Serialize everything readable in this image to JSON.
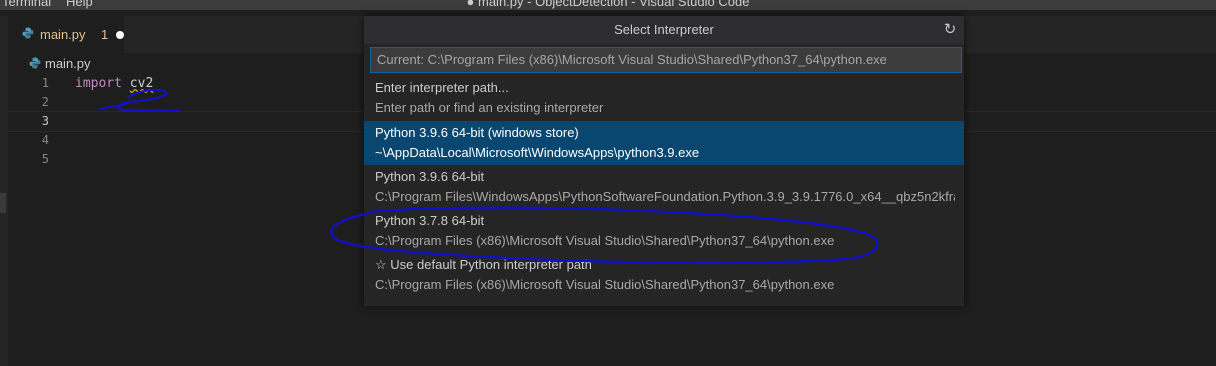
{
  "menu": {
    "terminal": "Terminal",
    "help": "Help"
  },
  "window_title": "● main.py - ObjectDetection - Visual Studio Code",
  "tab": {
    "name": "main.py",
    "problem_count": "1"
  },
  "breadcrumb": {
    "file": "main.py"
  },
  "editor": {
    "line_numbers": [
      "1",
      "2",
      "3",
      "4",
      "5"
    ],
    "line1": {
      "keyword": "import",
      "module": "cv2"
    }
  },
  "quick_pick": {
    "title": "Select Interpreter",
    "input_placeholder": "Current: C:\\Program Files (x86)\\Microsoft Visual Studio\\Shared\\Python37_64\\python.exe",
    "items": [
      {
        "label": "Enter interpreter path...",
        "detail": "Enter path or find an existing interpreter"
      },
      {
        "label": "Python 3.9.6 64-bit (windows store)",
        "detail": "~\\AppData\\Local\\Microsoft\\WindowsApps\\python3.9.exe"
      },
      {
        "label": "Python 3.9.6 64-bit",
        "detail": "C:\\Program Files\\WindowsApps\\PythonSoftwareFoundation.Python.3.9_3.9.1776.0_x64__qbz5n2kfra..."
      },
      {
        "label": "Python 3.7.8 64-bit",
        "detail": "C:\\Program Files (x86)\\Microsoft Visual Studio\\Shared\\Python37_64\\python.exe"
      },
      {
        "label": "Use default Python interpreter path",
        "detail": "C:\\Program Files (x86)\\Microsoft Visual Studio\\Shared\\Python37_64\\python.exe"
      }
    ]
  },
  "colors": {
    "editor_bg": "#1e1e1e",
    "selected_item_bg": "#094771",
    "modified_tab_text": "#e2c08d",
    "keyword": "#c586c0",
    "annotation_ink": "#1010d0"
  },
  "icons": {
    "python_file": "python-icon",
    "refresh": "refresh-icon",
    "star": "star-icon",
    "dirty": "unsaved-dot-icon"
  }
}
